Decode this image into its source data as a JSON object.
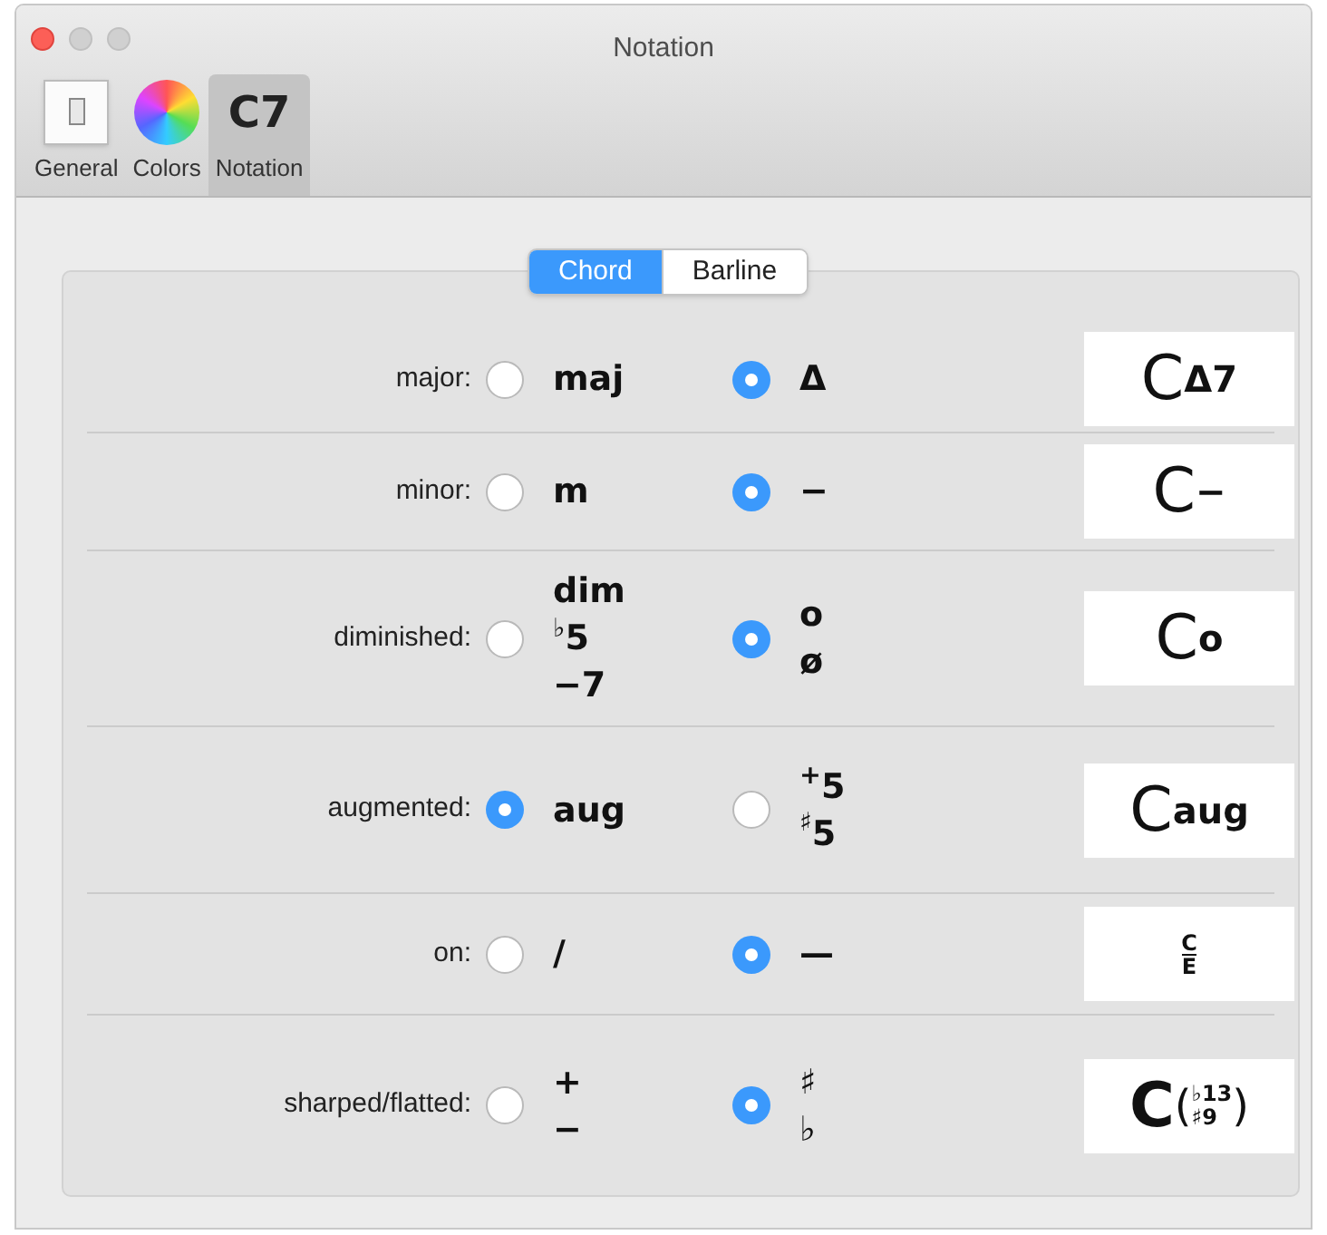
{
  "window": {
    "title": "Notation"
  },
  "toolbar": [
    {
      "label": "General",
      "kind": "switch",
      "selected": false
    },
    {
      "label": "Colors",
      "kind": "wheel",
      "selected": false
    },
    {
      "label": "Notation",
      "kind": "text",
      "icon_text": "C7",
      "selected": true
    }
  ],
  "segments": [
    {
      "label": "Chord",
      "selected": true
    },
    {
      "label": "Barline",
      "selected": false
    }
  ],
  "rows": [
    {
      "label": "major:",
      "options": [
        {
          "lines": [
            "maj"
          ],
          "selected": false
        },
        {
          "lines": [
            "Δ"
          ],
          "selected": true
        }
      ],
      "preview": {
        "kind": "suffix",
        "root": "C",
        "suffix": "Δ7"
      }
    },
    {
      "label": "minor:",
      "options": [
        {
          "lines": [
            "m"
          ],
          "selected": false
        },
        {
          "lines": [
            "−"
          ],
          "selected": true
        }
      ],
      "preview": {
        "kind": "suffix",
        "root": "C",
        "suffix": "−"
      }
    },
    {
      "label": "diminished:",
      "options": [
        {
          "lines": [
            "dim",
            "$^{♭}$5",
            "−7"
          ],
          "selected": false
        },
        {
          "lines": [
            "o",
            "ø"
          ],
          "selected": true
        }
      ],
      "preview": {
        "kind": "suffix",
        "root": "C",
        "suffix": "o"
      }
    },
    {
      "label": "augmented:",
      "options": [
        {
          "lines": [
            "aug"
          ],
          "selected": true
        },
        {
          "lines": [
            "$^{+}$5",
            "$^{♯}$5"
          ],
          "selected": false
        }
      ],
      "preview": {
        "kind": "suffix",
        "root": "C",
        "suffix": "aug"
      }
    },
    {
      "label": "on:",
      "options": [
        {
          "lines": [
            "/"
          ],
          "selected": false
        },
        {
          "lines": [
            "—"
          ],
          "selected": true
        }
      ],
      "preview": {
        "kind": "stacked",
        "top": "C",
        "bottom": "E"
      }
    },
    {
      "label": "sharped/flatted:",
      "options": [
        {
          "lines": [
            "+",
            "−"
          ],
          "selected": false
        },
        {
          "lines": [
            "♯",
            "♭"
          ],
          "selected": true
        }
      ],
      "preview": {
        "kind": "paren",
        "root": "C",
        "open": "(",
        "top": "♭13",
        "bottom": "♯9",
        "close": ")"
      }
    }
  ]
}
